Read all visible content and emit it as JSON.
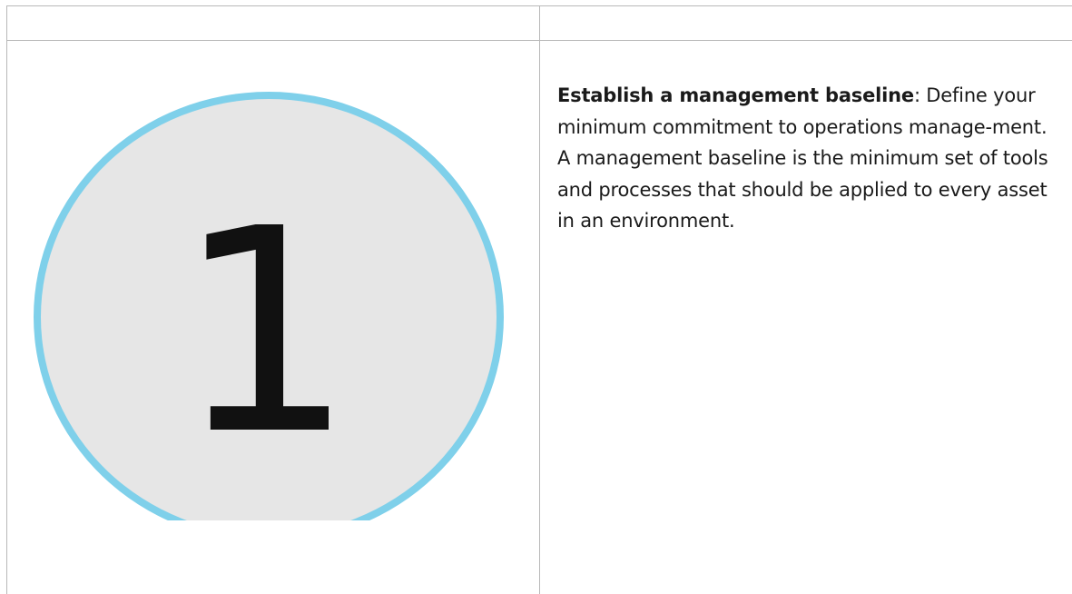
{
  "table": {
    "header": [
      "",
      ""
    ],
    "row": {
      "step_number": "1",
      "step_circle_colors": {
        "ring": "#7fd0ea",
        "fill": "#e6e6e6",
        "number": "#111111"
      },
      "title": "Establish a management baseline",
      "separator": ":",
      "description": " Define your minimum commitment to operations manage-ment. A management baseline is the minimum set of tools and processes that should be applied to every asset in an environment."
    }
  }
}
